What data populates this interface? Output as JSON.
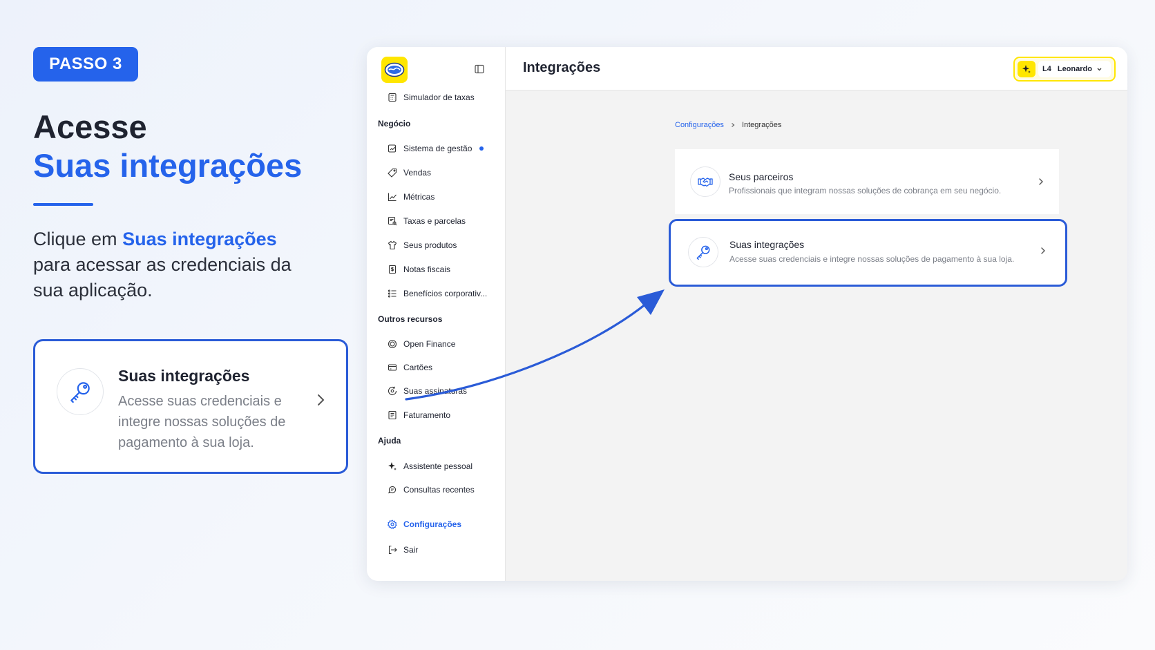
{
  "left_panel": {
    "badge": "PASSO 3",
    "heading_line1": "Acesse",
    "heading_line2": "Suas integrações",
    "description_prefix": "Clique em ",
    "description_highlight": "Suas integrações",
    "description_suffix": " para acessar as credenciais da sua aplicação.",
    "callout": {
      "title": "Suas integrações",
      "description": "Acesse suas credenciais e integre nossas soluções de pagamento à sua loja.",
      "icon": "key-icon"
    }
  },
  "app": {
    "page_title": "Integrações",
    "user": {
      "initials": "L4",
      "name": "Leonardo"
    },
    "sidebar": {
      "top_item": "Simulador de taxas",
      "sections": [
        {
          "title": "Negócio",
          "items": [
            {
              "label": "Sistema de gestão",
              "icon": "chart-edit-icon",
              "new_dot": true
            },
            {
              "label": "Vendas",
              "icon": "tag-icon"
            },
            {
              "label": "Métricas",
              "icon": "line-chart-icon"
            },
            {
              "label": "Taxas e parcelas",
              "icon": "receipt-search-icon"
            },
            {
              "label": "Seus produtos",
              "icon": "shirt-icon"
            },
            {
              "label": "Notas fiscais",
              "icon": "invoice-icon"
            },
            {
              "label": "Benefícios corporativ...",
              "icon": "list-icon"
            }
          ]
        },
        {
          "title": "Outros recursos",
          "items": [
            {
              "label": "Open Finance",
              "icon": "open-finance-icon"
            },
            {
              "label": "Cartões",
              "icon": "card-icon"
            },
            {
              "label": "Suas assinaturas",
              "icon": "subscription-icon"
            },
            {
              "label": "Faturamento",
              "icon": "billing-icon"
            }
          ]
        },
        {
          "title": "Ajuda",
          "items": [
            {
              "label": "Assistente pessoal",
              "icon": "sparkle-icon"
            },
            {
              "label": "Consultas recentes",
              "icon": "chat-icon"
            }
          ]
        }
      ],
      "settings": "Configurações",
      "logout": "Sair"
    },
    "breadcrumb": {
      "parent": "Configurações",
      "current": "Integrações"
    },
    "cards": [
      {
        "title": "Seus parceiros",
        "description": "Profissionais que integram nossas soluções de cobrança em seu negócio.",
        "icon": "handshake-icon"
      },
      {
        "title": "Suas integrações",
        "description": "Acesse suas credenciais e integre nossas soluções de pagamento à sua loja.",
        "icon": "key-icon",
        "highlighted": true
      }
    ]
  },
  "colors": {
    "accent": "#2563eb",
    "brand_yellow": "#ffe600",
    "highlight_border": "#2a5bd7"
  }
}
